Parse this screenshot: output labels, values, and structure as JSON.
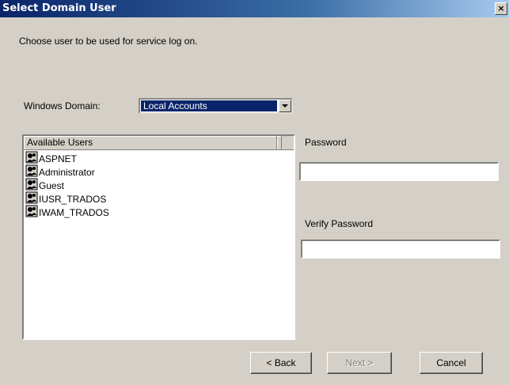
{
  "window": {
    "title": "Select Domain User",
    "close_label": "×"
  },
  "description": "Choose user to be used for service log on.",
  "domain": {
    "label": "Windows Domain:",
    "value": "Local Accounts"
  },
  "users_list": {
    "header": "Available Users",
    "items": [
      {
        "label": "ASPNET",
        "icon": "user-account-icon"
      },
      {
        "label": "Administrator",
        "icon": "user-account-icon"
      },
      {
        "label": "Guest",
        "icon": "user-account-icon"
      },
      {
        "label": "IUSR_TRADOS",
        "icon": "user-account-icon"
      },
      {
        "label": "IWAM_TRADOS",
        "icon": "user-account-icon"
      }
    ]
  },
  "password": {
    "label": "Password",
    "value": ""
  },
  "verify_password": {
    "label": "Verify Password",
    "value": ""
  },
  "buttons": {
    "back": "< Back",
    "next": "Next >",
    "cancel": "Cancel"
  },
  "colors": {
    "title_bar": "#0a246a",
    "selection": "#0a246a",
    "dialog_bg": "#d4d0c8"
  }
}
